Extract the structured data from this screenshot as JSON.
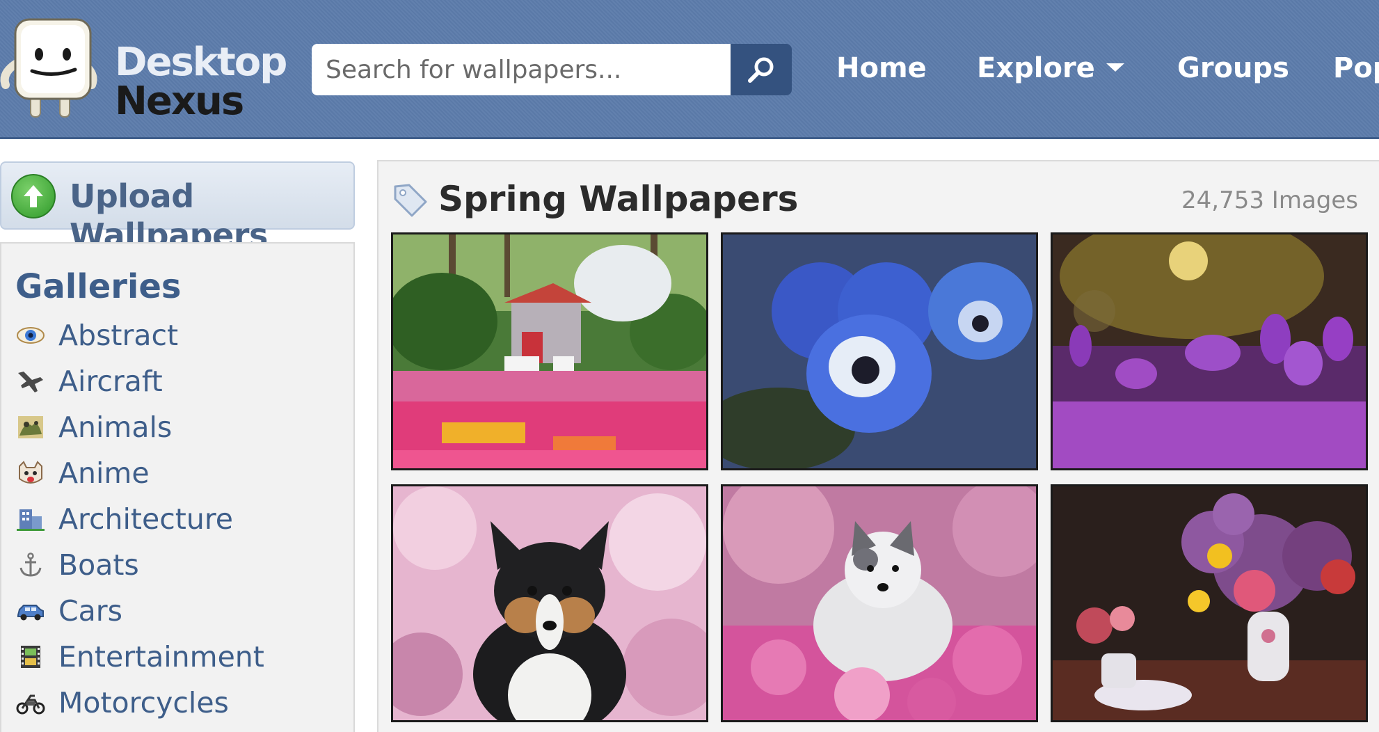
{
  "brand": {
    "line1": "Desktop",
    "line2": "Nexus"
  },
  "search": {
    "placeholder": "Search for wallpapers..."
  },
  "nav": [
    {
      "label": "Home"
    },
    {
      "label": "Explore",
      "has_dropdown": true
    },
    {
      "label": "Groups"
    },
    {
      "label": "Pop"
    }
  ],
  "sidebar": {
    "upload_label": "Upload Wallpapers",
    "galleries_title": "Galleries",
    "galleries": [
      {
        "label": "Abstract",
        "icon": "eye-icon"
      },
      {
        "label": "Aircraft",
        "icon": "airplane-icon"
      },
      {
        "label": "Animals",
        "icon": "animals-icon"
      },
      {
        "label": "Anime",
        "icon": "anime-face-icon"
      },
      {
        "label": "Architecture",
        "icon": "building-icon"
      },
      {
        "label": "Boats",
        "icon": "anchor-icon"
      },
      {
        "label": "Cars",
        "icon": "car-icon"
      },
      {
        "label": "Entertainment",
        "icon": "film-strip-icon"
      },
      {
        "label": "Motorcycles",
        "icon": "motorcycle-icon"
      }
    ]
  },
  "main": {
    "title": "Spring Wallpapers",
    "count": "24,753 Images"
  },
  "colors": {
    "header_bg": "#5c7cab",
    "search_button": "#34527f",
    "link_blue": "#3e5e8a"
  }
}
